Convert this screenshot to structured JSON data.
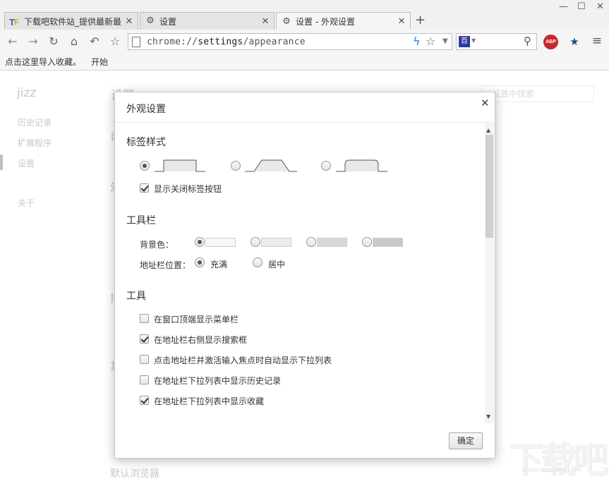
{
  "browser": {
    "tabs": [
      {
        "title": "下载吧软件站_提供最新最",
        "icon": "site-logo-icon",
        "active": false
      },
      {
        "title": "设置",
        "icon": "gear-icon",
        "active": false
      },
      {
        "title": "设置 - 外观设置",
        "icon": "gear-icon",
        "active": true
      }
    ],
    "new_tab_label": "+",
    "omnibox": {
      "scheme": "chrome://",
      "host": "settings",
      "path": "/appearance"
    },
    "search_engine_label": "百",
    "abp_label": "ABP",
    "bookmarks": [
      "点击这里导入收藏。",
      "开始"
    ]
  },
  "settings_page": {
    "logo": "jizz",
    "title": "设置",
    "search_placeholder": "设置中搜索",
    "nav": [
      "历史记录",
      "扩展程序",
      "设置",
      "关于"
    ],
    "fragments": [
      "自",
      "外",
      "拼",
      "其"
    ],
    "default_browser": "默认浏览器"
  },
  "dialog": {
    "title": "外观设置",
    "tab_style": {
      "title": "标签样式",
      "selected_index": 0,
      "show_close_label": "显示关闭标签按钮",
      "show_close_checked": true
    },
    "toolbar": {
      "title": "工具栏",
      "bg_label": "背景色：",
      "bg_colors": [
        "#f8f8f8",
        "#ececec",
        "#d8d8d8",
        "#c9c9c9"
      ],
      "bg_selected_index": 0,
      "addr_label": "地址栏位置：",
      "addr_options": [
        "充满",
        "居中"
      ],
      "addr_selected_index": 0
    },
    "tools": {
      "title": "工具",
      "items": [
        {
          "label": "在窗口顶端显示菜单栏",
          "checked": false
        },
        {
          "label": "在地址栏右侧显示搜索框",
          "checked": true
        },
        {
          "label": "点击地址栏并激活输入焦点时自动显示下拉列表",
          "checked": false
        },
        {
          "label": "在地址栏下拉列表中显示历史记录",
          "checked": false
        },
        {
          "label": "在地址栏下拉列表中显示收藏",
          "checked": true
        }
      ]
    },
    "ok_label": "确定"
  },
  "watermark": {
    "text": "下载吧",
    "url": "www.xiazaiba.com"
  }
}
